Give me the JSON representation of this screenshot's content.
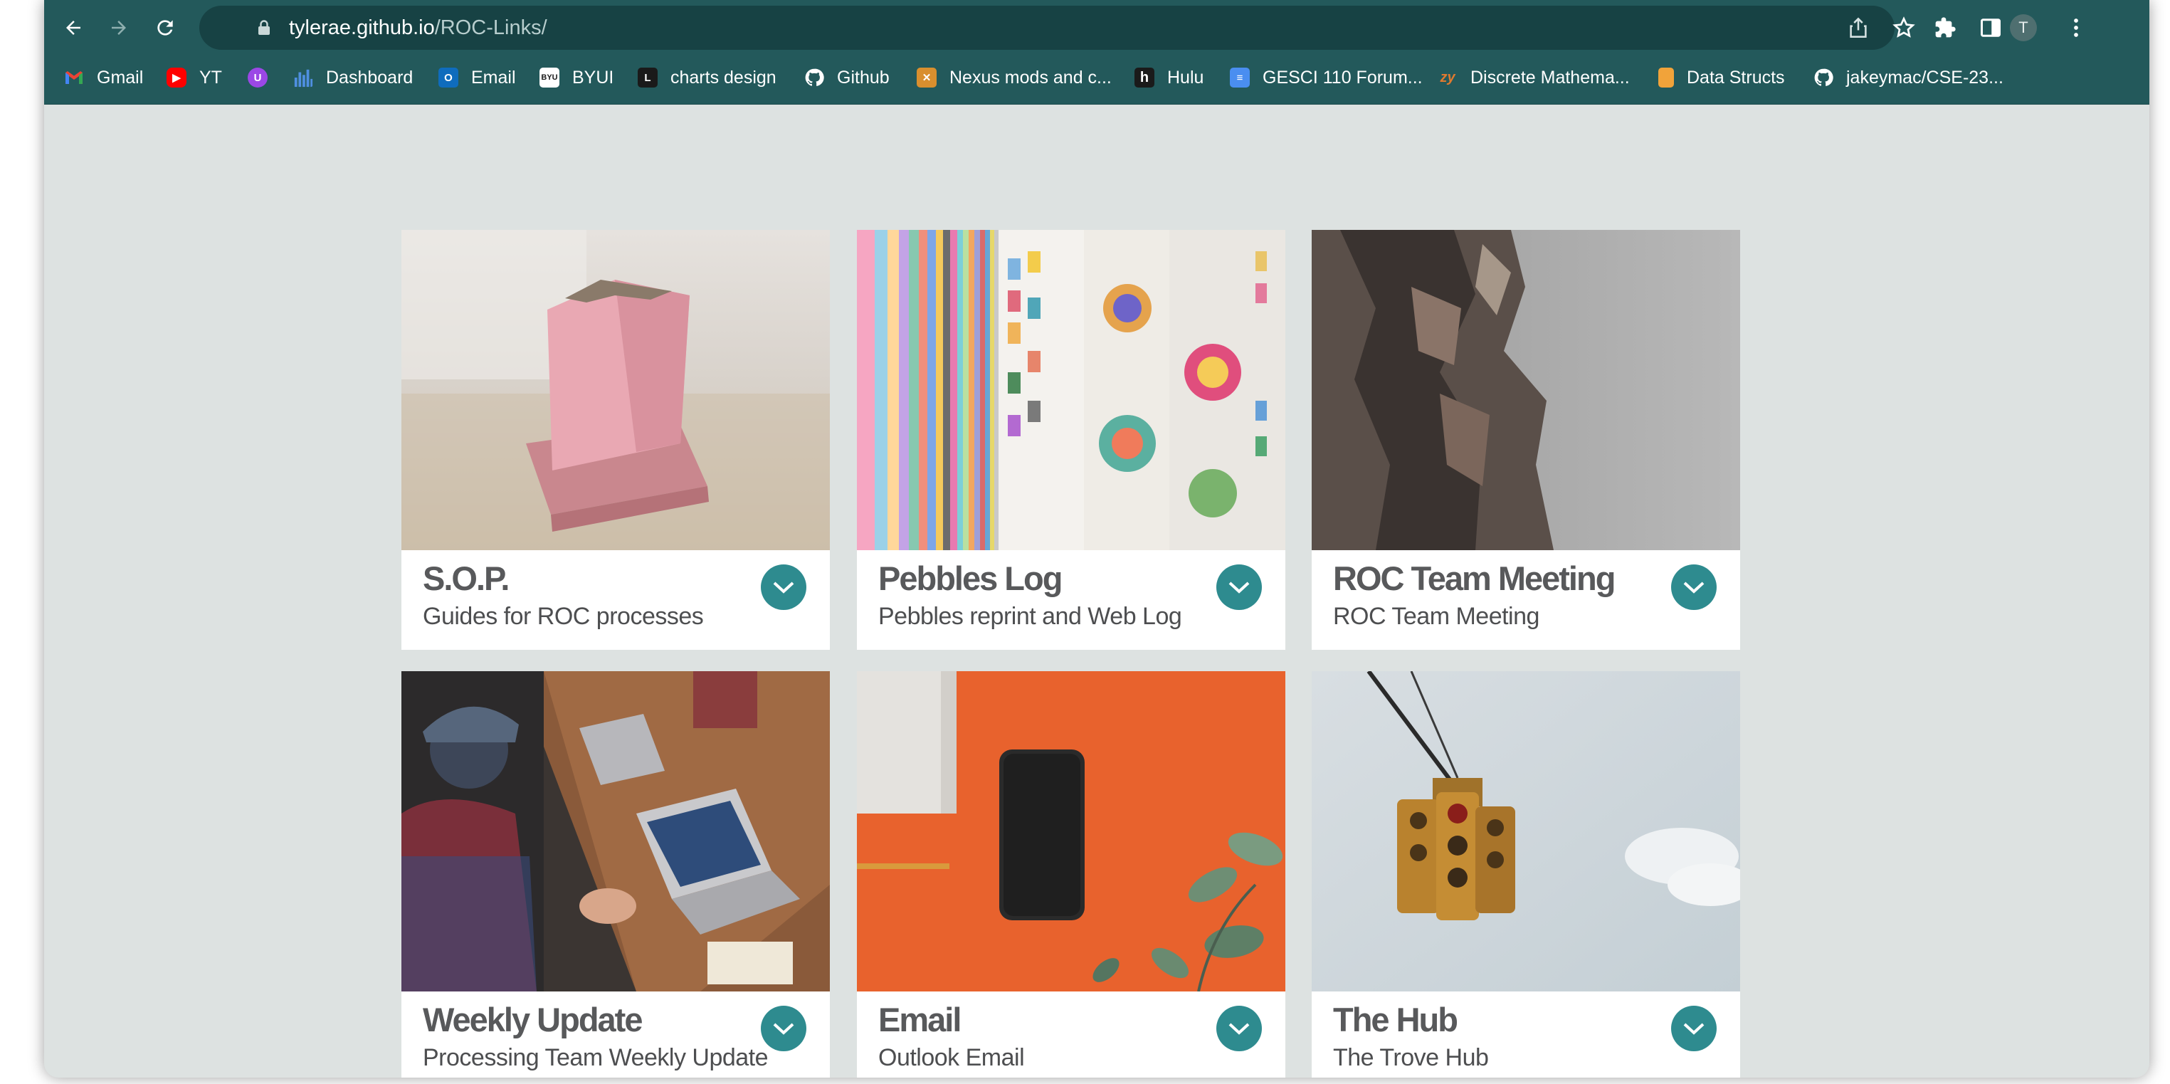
{
  "browser": {
    "url_host": "tylerae.github.io",
    "url_path": "/ROC-Links/",
    "profile_initial": "T",
    "colors": {
      "frame": "#23595b",
      "omnibox": "#174244"
    },
    "icons": [
      "back-arrow-icon",
      "forward-arrow-icon",
      "reload-icon",
      "lock-icon",
      "share-icon",
      "star-icon",
      "puzzle-icon",
      "side-panel-icon",
      "kebab-menu-icon"
    ]
  },
  "bookmarks": [
    {
      "label": "Gmail"
    },
    {
      "label": "YT"
    },
    {
      "label": ""
    },
    {
      "label": "Dashboard"
    },
    {
      "label": "Email"
    },
    {
      "label": "BYUI"
    },
    {
      "label": "charts design"
    },
    {
      "label": "Github"
    },
    {
      "label": "Nexus mods and c..."
    },
    {
      "label": "Hulu"
    },
    {
      "label": "GESCI 110 Forum..."
    },
    {
      "label": "Discrete Mathema..."
    },
    {
      "label": "Data Structs"
    },
    {
      "label": "jakeymac/CSE-23..."
    }
  ],
  "cards": [
    {
      "title": "S.O.P.",
      "subtitle": "Guides for ROC processes"
    },
    {
      "title": "Pebbles Log",
      "subtitle": "Pebbles reprint and Web Log"
    },
    {
      "title": "ROC Team Meeting",
      "subtitle": "ROC Team Meeting"
    },
    {
      "title": "Weekly Update",
      "subtitle": "Processing Team Weekly Update"
    },
    {
      "title": "Email",
      "subtitle": "Outlook Email"
    },
    {
      "title": "The Hub",
      "subtitle": "The Trove Hub"
    }
  ],
  "theme": {
    "page_bg": "#dde2e1",
    "card_bg": "#ffffff",
    "accent": "#2e8b8f",
    "title": "#58595b"
  }
}
